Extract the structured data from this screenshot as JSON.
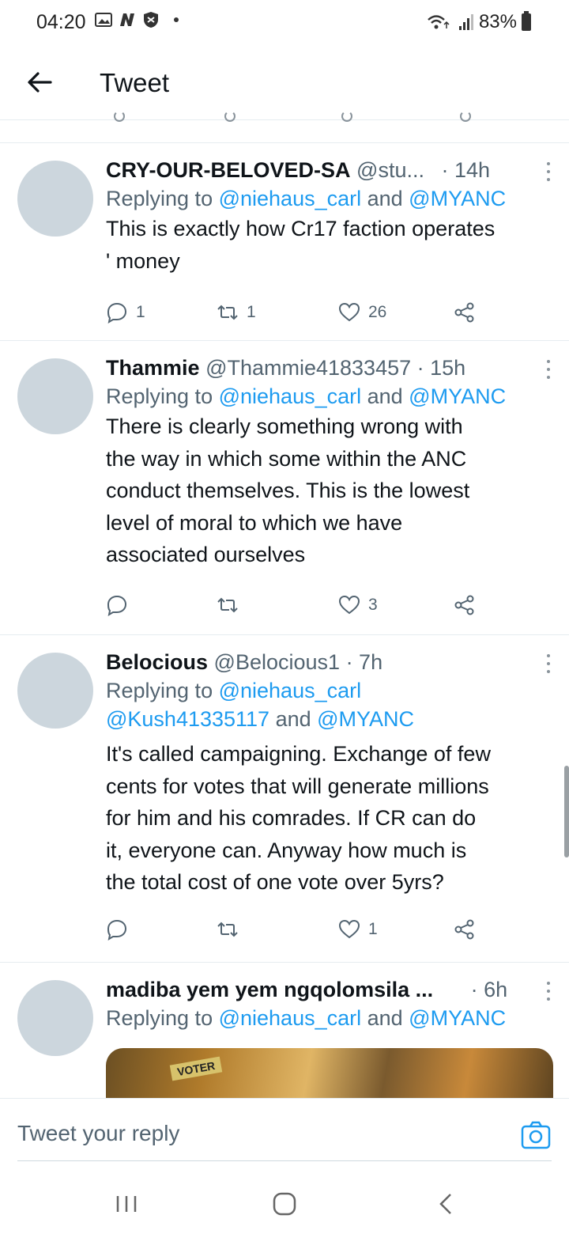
{
  "status_bar": {
    "time": "04:20",
    "battery": "83%"
  },
  "header": {
    "title": "Tweet"
  },
  "tweets": [
    {
      "name": "CRY-OUR-BELOVED-SA",
      "handle": "@stu...",
      "time": "· 14h",
      "reply_prefix": "Replying to ",
      "reply_users": "@niehaus_carl",
      "reply_and": " and ",
      "reply_users2": "@MYANC",
      "text_lines": [
        "This is exactly how Cr17 faction operates",
        "' money"
      ],
      "replies": "1",
      "retweets": "1",
      "likes": "26"
    },
    {
      "name": "Thammie",
      "handle": "@Thammie41833457",
      "time": "· 15h",
      "reply_prefix": "Replying to ",
      "reply_users": "@niehaus_carl",
      "reply_and": " and ",
      "reply_users2": "@MYANC",
      "text_lines": [
        "There is clearly something wrong with",
        "the way in which some within the ANC",
        "conduct themselves. This is the lowest",
        "level of moral to which we have",
        "associated ourselves"
      ],
      "replies": "",
      "retweets": "",
      "likes": "3"
    },
    {
      "name": "Belocious",
      "handle": "@Belocious1",
      "time": "· 7h",
      "reply_prefix": "Replying to ",
      "reply_users": "@niehaus_carl",
      "reply_line2_user": "@Kush41335117",
      "reply_and": " and ",
      "reply_users2": "@MYANC",
      "text_lines": [
        "It's called campaigning. Exchange of few",
        "cents for votes that will generate millions",
        "for him and his comrades. If CR can do",
        "it, everyone can. Anyway how much is",
        "the total cost of one vote over 5yrs?"
      ],
      "replies": "",
      "retweets": "",
      "likes": "1"
    },
    {
      "name": "madiba yem yem ngqolomsila ...",
      "handle": "",
      "time": "· 6h",
      "reply_prefix": "Replying to ",
      "reply_users": "@niehaus_carl",
      "reply_and": " and ",
      "reply_users2": "@MYANC",
      "media_label": "VOTER"
    }
  ],
  "reply_bar": {
    "placeholder": "Tweet your reply"
  },
  "icons": {
    "back": "arrow-left-icon",
    "more": "more-vertical-icon",
    "reply": "comment-icon",
    "retweet": "retweet-icon",
    "like": "heart-icon",
    "share": "share-icon",
    "camera": "camera-icon"
  },
  "colors": {
    "accent": "#1d9bf0",
    "secondary_text": "#536471",
    "avatar_placeholder": "#ccd6dd"
  }
}
